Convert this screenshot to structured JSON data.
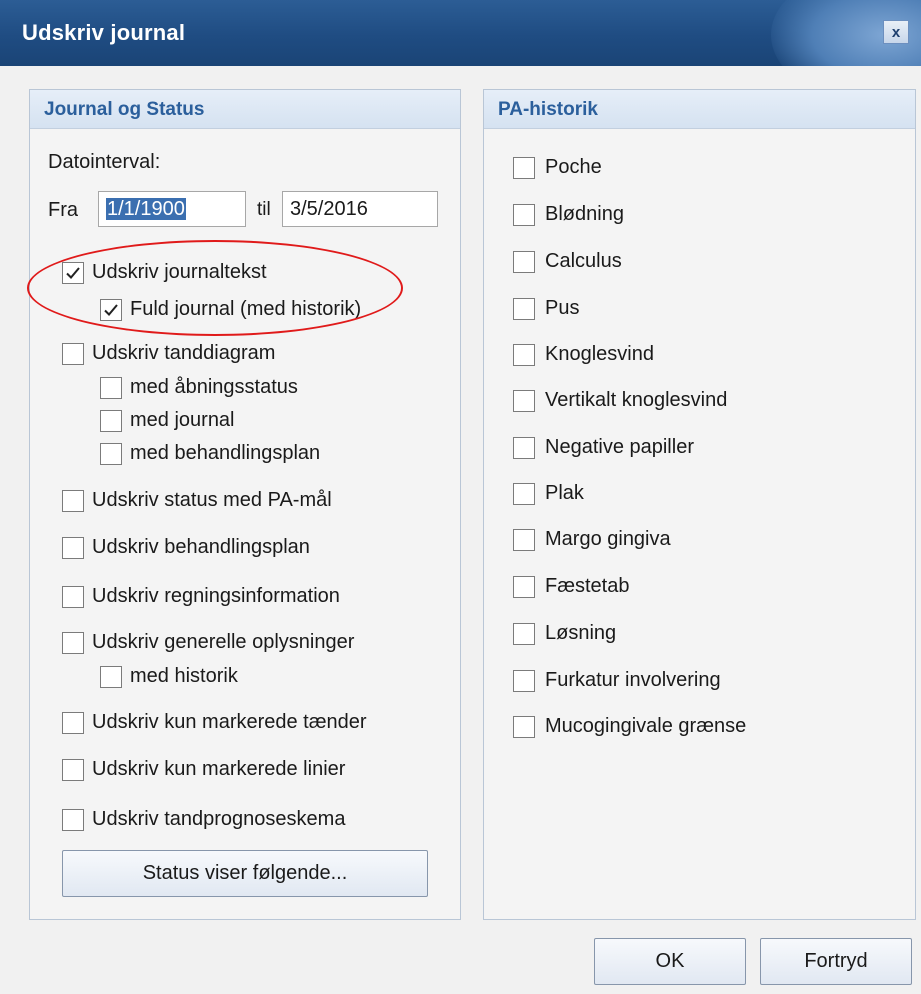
{
  "window": {
    "title": "Udskriv journal",
    "close_label": "x"
  },
  "left_group": {
    "title": "Journal og Status",
    "date_label": "Datointerval:",
    "from_label": "Fra",
    "from_value": "1/1/1900",
    "to_label": "til",
    "to_value": "3/5/2016",
    "options": [
      {
        "label": "Udskriv journaltekst",
        "checked": true
      },
      {
        "label": "Fuld journal (med historik)",
        "checked": true
      },
      {
        "label": "Udskriv tanddiagram",
        "checked": false
      },
      {
        "label": "med åbningsstatus",
        "checked": false
      },
      {
        "label": "med journal",
        "checked": false
      },
      {
        "label": "med behandlingsplan",
        "checked": false
      },
      {
        "label": "Udskriv status med PA-mål",
        "checked": false
      },
      {
        "label": "Udskriv behandlingsplan",
        "checked": false
      },
      {
        "label": "Udskriv regningsinformation",
        "checked": false
      },
      {
        "label": "Udskriv generelle oplysninger",
        "checked": false
      },
      {
        "label": "med historik",
        "checked": false
      },
      {
        "label": "Udskriv kun markerede tænder",
        "checked": false
      },
      {
        "label": "Udskriv kun markerede linier",
        "checked": false
      },
      {
        "label": "Udskriv tandprognoseskema",
        "checked": false
      }
    ],
    "status_button": "Status viser følgende..."
  },
  "right_group": {
    "title": "PA-historik",
    "options": [
      {
        "label": "Poche",
        "checked": false
      },
      {
        "label": "Blødning",
        "checked": false
      },
      {
        "label": "Calculus",
        "checked": false
      },
      {
        "label": "Pus",
        "checked": false
      },
      {
        "label": "Knoglesvind",
        "checked": false
      },
      {
        "label": "Vertikalt knoglesvind",
        "checked": false
      },
      {
        "label": "Negative papiller",
        "checked": false
      },
      {
        "label": "Plak",
        "checked": false
      },
      {
        "label": "Margo gingiva",
        "checked": false
      },
      {
        "label": "Fæstetab",
        "checked": false
      },
      {
        "label": "Løsning",
        "checked": false
      },
      {
        "label": "Furkatur involvering",
        "checked": false
      },
      {
        "label": "Mucogingivale grænse",
        "checked": false
      }
    ]
  },
  "footer": {
    "ok_label": "OK",
    "cancel_label": "Fortryd"
  },
  "colors": {
    "titlebar": "#1f4c82",
    "group_title": "#2b5f9c",
    "annotation": "#e01a1a",
    "selection": "#3b6fb0"
  }
}
